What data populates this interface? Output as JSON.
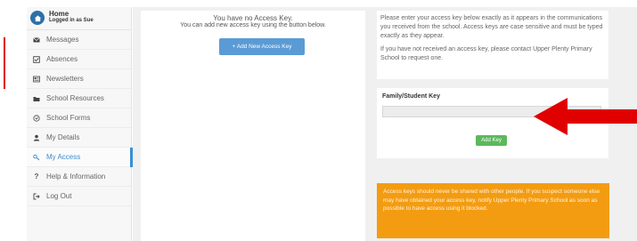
{
  "sidebar": {
    "home_title": "Home",
    "home_subtitle": "Logged in as Sue",
    "items": [
      {
        "label": "Messages",
        "icon": "envelope-icon"
      },
      {
        "label": "Absences",
        "icon": "checkbox-icon"
      },
      {
        "label": "Newsletters",
        "icon": "newspaper-icon"
      },
      {
        "label": "School Resources",
        "icon": "folder-icon"
      },
      {
        "label": "School Forms",
        "icon": "form-icon"
      },
      {
        "label": "My Details",
        "icon": "user-icon"
      },
      {
        "label": "My Access",
        "icon": "key-icon",
        "active": true
      },
      {
        "label": "Help & Information",
        "icon": "question-icon"
      },
      {
        "label": "Log Out",
        "icon": "logout-icon"
      }
    ]
  },
  "access": {
    "no_key_title": "You have no Access Key.",
    "no_key_sub": "You can add new access key using the button below.",
    "add_new_button": "+ Add New Access Key"
  },
  "info": {
    "para1": "Please enter your access key below exactly as it appears in the communications you received from the school. Access keys are case sensitive and must be typed exactly as they appear.",
    "para2": "If you have not received an access key, please contact Upper Plenty Primary School to request one."
  },
  "key_form": {
    "label": "Family/Student Key",
    "value": "",
    "add_button": "Add Key"
  },
  "warning": {
    "text": "Access keys should never be shared with other people. If you suspect someone else may have obtained your access key, notify Upper Plenty Primary School as soon as possible to have access using it blocked."
  },
  "colors": {
    "accent": "#3a8fd0",
    "add_key_button": "#5cb85c",
    "warning": "#f39c12",
    "annotation_arrow": "#e00000"
  }
}
